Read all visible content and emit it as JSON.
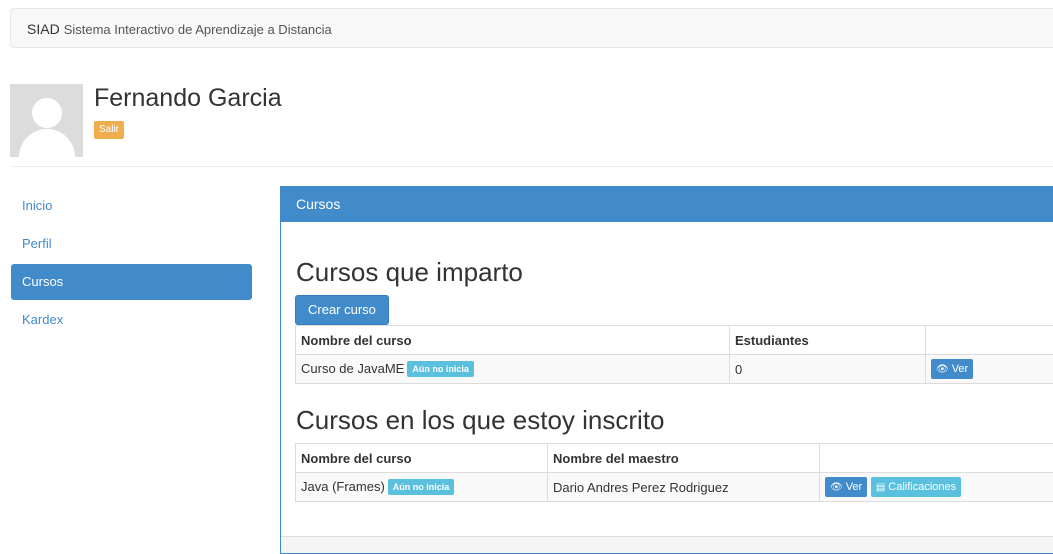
{
  "navbar": {
    "brand": "SIAD",
    "subtitle": "Sistema Interactivo de Aprendizaje a Distancia"
  },
  "profile": {
    "name": "Fernando Garcia",
    "logout_label": "Salir"
  },
  "sidebar": {
    "items": [
      {
        "label": "Inicio",
        "active": false
      },
      {
        "label": "Perfil",
        "active": false
      },
      {
        "label": "Cursos",
        "active": true
      },
      {
        "label": "Kardex",
        "active": false
      }
    ]
  },
  "panel": {
    "title": "Cursos"
  },
  "teaching": {
    "heading": "Cursos que imparto",
    "create_button": "Crear curso",
    "columns": [
      "Nombre del curso",
      "Estudiantes",
      ""
    ],
    "rows": [
      {
        "course": "Curso de JavaME",
        "badge": "Aún no inicia",
        "students": "0",
        "view_label": "Ver"
      }
    ]
  },
  "enrolled": {
    "heading": "Cursos en los que estoy inscrito",
    "columns": [
      "Nombre del curso",
      "Nombre del maestro",
      ""
    ],
    "rows": [
      {
        "course": "Java (Frames)",
        "badge": "Aún no inicia",
        "teacher": "Dario Andres Perez Rodriguez",
        "view_label": "Ver",
        "grades_label": "Calificaciones"
      }
    ]
  },
  "colors": {
    "primary": "#428bca",
    "info": "#5bc0de",
    "warning": "#f0ad4e"
  },
  "icons": {
    "view": "eye-icon",
    "grades": "list-icon"
  }
}
